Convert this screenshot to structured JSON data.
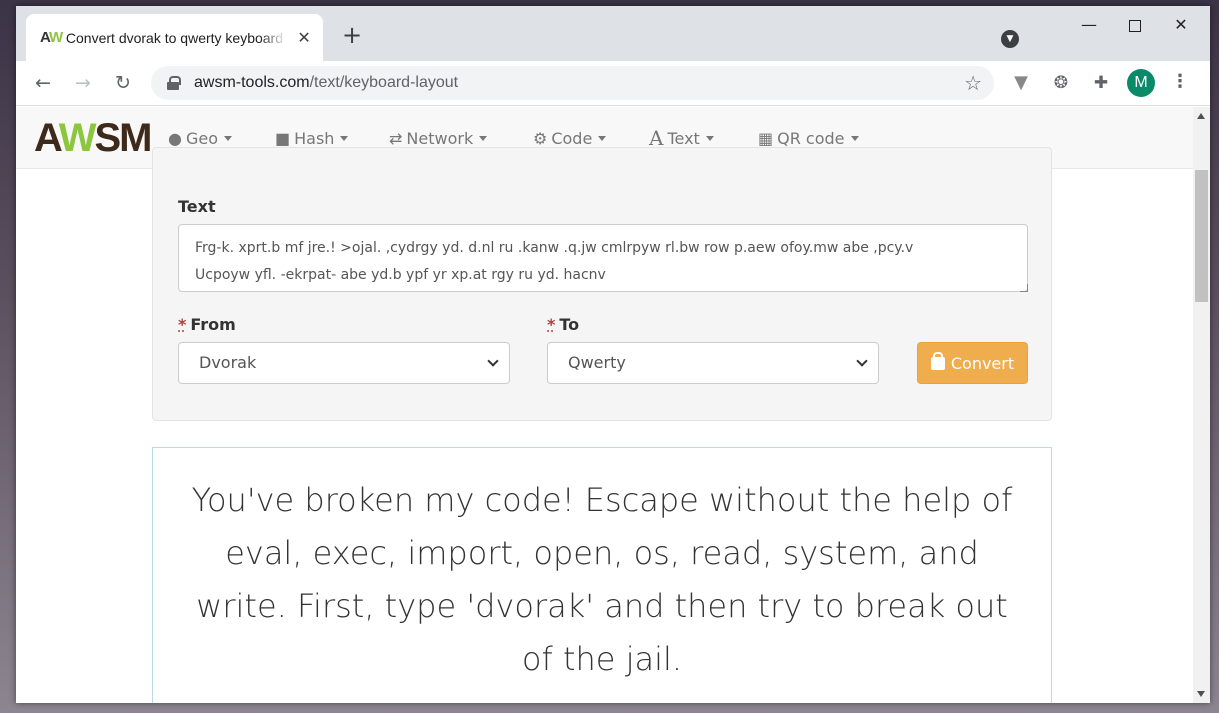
{
  "browser": {
    "tab_title": "Convert dvorak to qwerty keyboard layout",
    "tab_favicon": "AW",
    "url_host": "awsm-tools.com",
    "url_path": "/text/keyboard-layout",
    "avatar_letter": "M",
    "icons": [
      "back-icon",
      "forward-icon",
      "reload-icon",
      "lock-icon",
      "star-icon",
      "extensions-icon",
      "menu-icon"
    ]
  },
  "site": {
    "logo_left": "A",
    "logo_mid": "W",
    "logo_right": "SM",
    "nav": {
      "geo": "Geo",
      "hash": "Hash",
      "network": "Network",
      "code": "Code",
      "text": "Text",
      "qr": "QR code"
    }
  },
  "form": {
    "text_label": "Text",
    "text_value": "Frg-k. xprt.b mf jre.! >ojal. ,cydrgy yd. d.nl ru .kanw .q.jw cmlrpyw rl.bw row p.aew ofoy.mw abe ,pcy.v\nUcpoyw yfl. -ekrpat- abe yd.b ypf yr xp.at rgy ru yd. hacnv",
    "from_label": "From",
    "from_value": "Dvorak",
    "to_label": "To",
    "to_value": "Qwerty",
    "required_marker": "*",
    "convert_label": "Convert"
  },
  "output": {
    "text": "You've broken my code! Escape without the help of eval, exec, import, open, os, read, system, and write. First, type 'dvorak' and then try to break out of the jail."
  },
  "colors": {
    "accent": "#f0ad4e",
    "logo_green": "#8cc63f",
    "logo_brown": "#3d2a1a",
    "avatar": "#0b8a6a"
  }
}
